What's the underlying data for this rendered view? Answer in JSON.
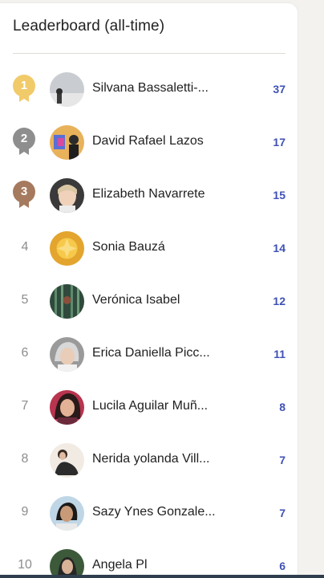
{
  "title": "Leaderboard (all-time)",
  "colors": {
    "gold": "#f1ca6a",
    "silver": "#8e8e8e",
    "bronze": "#a57a5e",
    "score": "#3f51b5"
  },
  "entries": [
    {
      "rank": "1",
      "name": "Silvana Bassaletti-...",
      "score": "37"
    },
    {
      "rank": "2",
      "name": "David Rafael Lazos",
      "score": "17"
    },
    {
      "rank": "3",
      "name": "Elizabeth Navarrete",
      "score": "15"
    },
    {
      "rank": "4",
      "name": "Sonia Bauzá",
      "score": "14"
    },
    {
      "rank": "5",
      "name": "Verónica Isabel",
      "score": "12"
    },
    {
      "rank": "6",
      "name": "Erica Daniella Picc...",
      "score": "11"
    },
    {
      "rank": "7",
      "name": "Lucila Aguilar Muñ...",
      "score": "8"
    },
    {
      "rank": "8",
      "name": "Nerida yolanda Vill...",
      "score": "7"
    },
    {
      "rank": "9",
      "name": "Sazy Ynes Gonzale...",
      "score": "7"
    },
    {
      "rank": "10",
      "name": "Angela Pl",
      "score": "6"
    }
  ]
}
